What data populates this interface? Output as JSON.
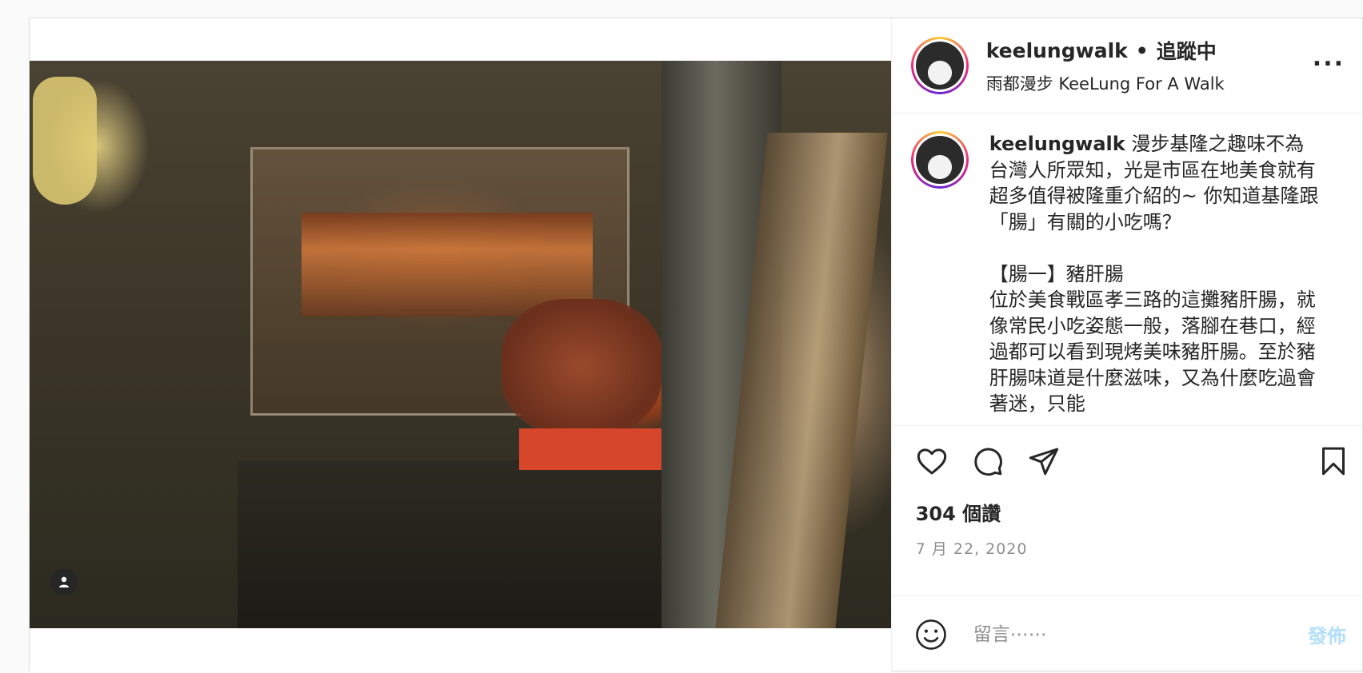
{
  "header": {
    "username": "keelungwalk",
    "separator": "•",
    "follow_status": "追蹤中",
    "subtitle": "雨都漫步 KeeLung For A Walk",
    "more_label": "..."
  },
  "caption": {
    "username": "keelungwalk",
    "text": " 漫步基隆之趣味不為台灣人所眾知，光是市區在地美食就有超多值得被隆重介紹的~ 你知道基隆跟「腸」有關的小吃嗎？\n\n【腸一】豬肝腸\n位於美食戰區孝三路的這攤豬肝腸，就像常民小吃姿態一般，落腳在巷口，經過都可以看到現烤美味豬肝腸。至於豬肝腸味道是什麼滋味，又為什麼吃過會著迷，只能"
  },
  "actions": {
    "like_icon": "heart-icon",
    "comment_icon": "comment-icon",
    "share_icon": "share-icon",
    "save_icon": "bookmark-icon"
  },
  "likes": "304 個讚",
  "date": "7 月 22, 2020",
  "comment": {
    "placeholder": "留言⋯⋯",
    "post_label": "發佈",
    "emoji_icon": "smiley-icon"
  },
  "colors": {
    "post_button_disabled": "#b2dffc",
    "secondary_text": "#8e8e8e",
    "border": "#dbdbdb"
  }
}
